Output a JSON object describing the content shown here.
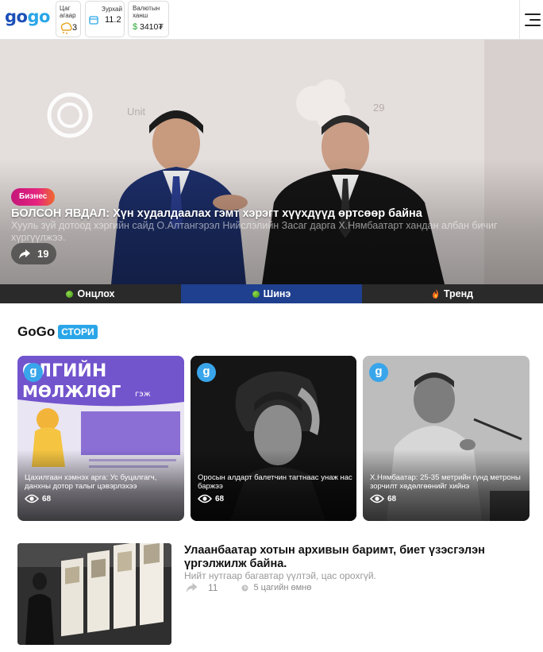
{
  "header": {
    "logo_part1": "go",
    "logo_part2": "go",
    "weather": {
      "label_line1": "Цаг",
      "label_line2": "агаар",
      "value": "3"
    },
    "currency_widget": {
      "label": "Зурхай",
      "value": "11.2"
    },
    "rate_widget": {
      "label_line1": "Валютын",
      "label_line2": "ханш",
      "symbol": "$",
      "value": "3410₮"
    }
  },
  "hero": {
    "category": "Бизнес",
    "title": "БОЛСОН ЯВДАЛ: Хүн худалдаалах гэмт хэрэгт хүүхдүүд өртсөөр байна",
    "subtitle": "Хууль зүй дотоод хэргийн сайд О.Алтангэрэл Нийслэлийн Засаг дарга Х.Нямбаатарт хандан албан бичиг хүргүүлжээ.",
    "backdrop_text_1": "Unit",
    "backdrop_text_2": "29",
    "share_count": "19"
  },
  "tabs": [
    {
      "label": "Онцлох",
      "icon": "green-dot-icon"
    },
    {
      "label": "Шинэ",
      "icon": "green-dot-icon"
    },
    {
      "label": "Тренд",
      "icon": "fire-icon"
    }
  ],
  "stories": {
    "title": "GoGo",
    "tag": "СТОРИ",
    "items": [
      {
        "caption": "Цахилгаан хэмнэх арга: Ус буцалгагч, данхны дотор талыг цэвэрлэхээ",
        "views": "68",
        "overlay_big": "ОЛГИЙН",
        "overlay_big2": "МӨЛЖЛӨГ",
        "overlay_small": "гэж"
      },
      {
        "caption": "Оросын алдарт балетчин тагтнаас унаж нас баржээ",
        "views": "68"
      },
      {
        "caption": "Х.Нямбаатар: 25-35 метрийн гүнд метроны зорчилт хөдөлгөөнийг хийнэ",
        "views": "68"
      }
    ]
  },
  "article": {
    "title": "Улаанбаатар хотын архивын баримт, биет үзэсгэлэн үргэлжилж байна.",
    "subtitle": "Нийт нутгаар багавтар үүлтэй, цас орохгүй.",
    "shares": "11",
    "time": "5 цагийн өмнө"
  },
  "colors": {
    "brand_dark": "#1c4fb8",
    "brand_light": "#2aa6e8",
    "tab_active": "#1f3f8f",
    "tabs_bg": "#2a2a2a"
  }
}
